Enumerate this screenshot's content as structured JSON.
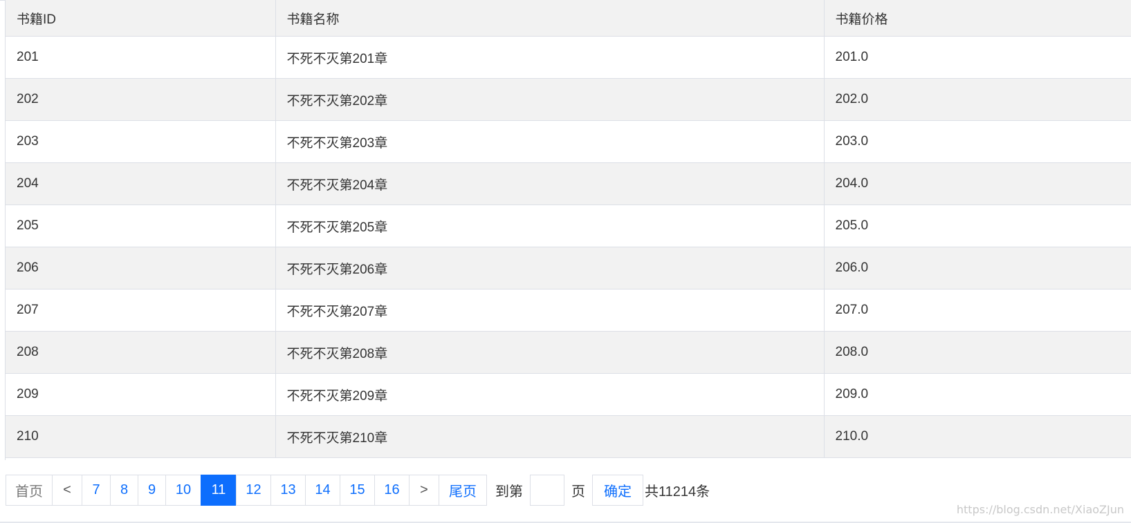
{
  "table": {
    "headers": [
      "书籍ID",
      "书籍名称",
      "书籍价格"
    ],
    "rows": [
      [
        "201",
        "不死不灭第201章",
        "201.0"
      ],
      [
        "202",
        "不死不灭第202章",
        "202.0"
      ],
      [
        "203",
        "不死不灭第203章",
        "203.0"
      ],
      [
        "204",
        "不死不灭第204章",
        "204.0"
      ],
      [
        "205",
        "不死不灭第205章",
        "205.0"
      ],
      [
        "206",
        "不死不灭第206章",
        "206.0"
      ],
      [
        "207",
        "不死不灭第207章",
        "207.0"
      ],
      [
        "208",
        "不死不灭第208章",
        "208.0"
      ],
      [
        "209",
        "不死不灭第209章",
        "209.0"
      ],
      [
        "210",
        "不死不灭第210章",
        "210.0"
      ]
    ]
  },
  "pagination": {
    "first": "首页",
    "prev": "<",
    "pages": [
      "7",
      "8",
      "9",
      "10",
      "11",
      "12",
      "13",
      "14",
      "15",
      "16"
    ],
    "current": "11",
    "next": ">",
    "last": "尾页",
    "goto_label": "到第",
    "goto_value": "",
    "page_label": "页",
    "confirm": "确定",
    "total": "共11214条"
  },
  "watermark": "https://blog.csdn.net/XiaoZJun",
  "colors": {
    "accent": "#0d6efd",
    "stripe": "#f2f2f2",
    "border": "#dcdfe6"
  }
}
